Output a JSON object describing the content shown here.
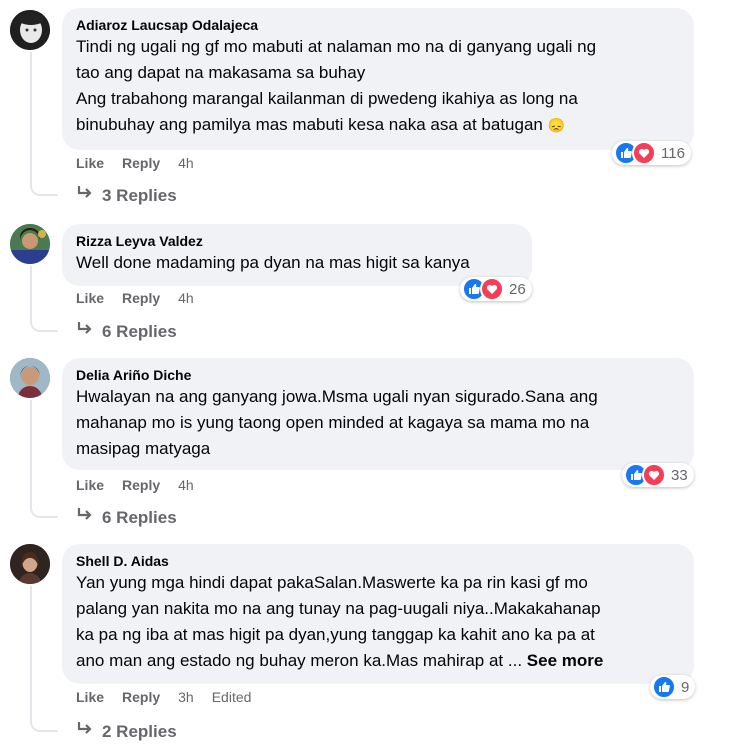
{
  "comments": [
    {
      "author": "Adiaroz Laucsap Odalajeca",
      "lines": [
        "Tindi ng ugali ng gf mo mabuti at nalaman mo na di ganyang ugali ng",
        "tao ang dapat na makasama sa buhay",
        "Ang trabahong marangal kailanman di pwedeng ikahiya as long na",
        "binubuhay ang pamilya mas mabuti kesa naka asa at batugan"
      ],
      "emoji": "😞",
      "like_label": "Like",
      "reply_label": "Reply",
      "time": "4h",
      "reaction_count": "116",
      "replies_label": "3 Replies"
    },
    {
      "author": "Rizza Leyva Valdez",
      "lines": [
        "Well done madaming pa dyan na mas higit sa kanya"
      ],
      "like_label": "Like",
      "reply_label": "Reply",
      "time": "4h",
      "reaction_count": "26",
      "replies_label": "6 Replies"
    },
    {
      "author": "Delia Ariño Diche",
      "lines": [
        "Hwalayan na ang ganyang jowa.Msma ugali nyan sigurado.Sana ang",
        "mahanap mo is yung taong open minded at kagaya sa mama mo na",
        "masipag matyaga"
      ],
      "like_label": "Like",
      "reply_label": "Reply",
      "time": "4h",
      "reaction_count": "33",
      "replies_label": "6 Replies"
    },
    {
      "author": "Shell D. Aidas",
      "lines": [
        "Yan yung mga hindi dapat pakaSalan.Maswerte ka pa rin kasi gf mo",
        "palang yan nakita mo na ang tunay na pag-uugali niya..Makakahanap",
        "ka pa ng iba at mas higit pa dyan,yung tanggap ka kahit ano ka pa at",
        "ano man ang estado ng buhay meron ka.Mas mahirap at ..."
      ],
      "see_more": "See more",
      "like_label": "Like",
      "reply_label": "Reply",
      "time": "3h",
      "edited": "Edited",
      "reaction_count": "9",
      "replies_label": "2 Replies"
    }
  ],
  "colors": {
    "bubble": "#f0f2f5",
    "meta": "#65676b",
    "like_blue": "#1877f2",
    "love_red": "#f33e58"
  }
}
